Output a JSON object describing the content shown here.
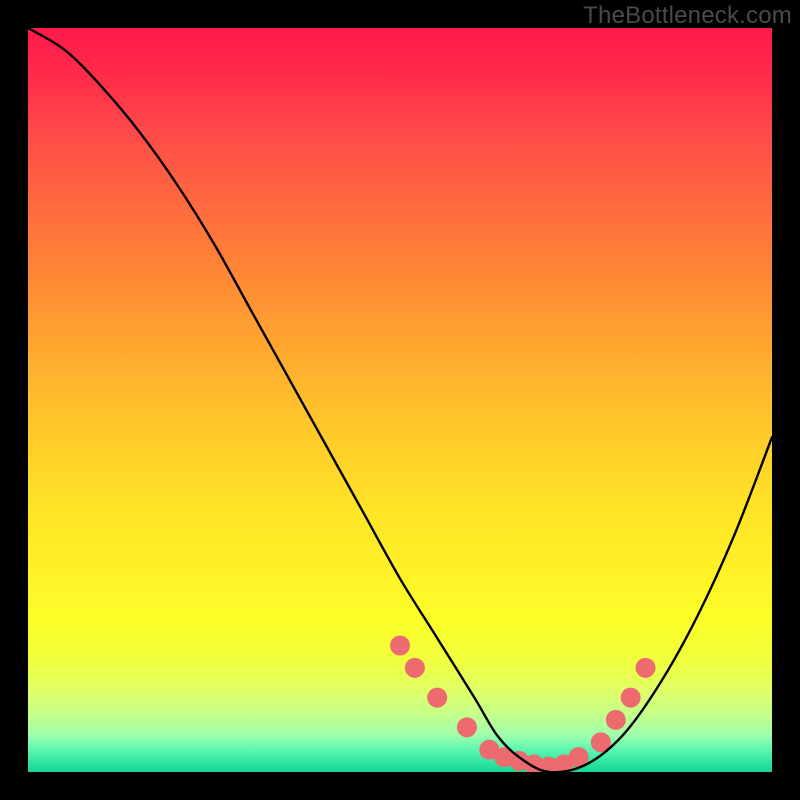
{
  "watermark": "TheBottleneck.com",
  "chart_data": {
    "type": "line",
    "title": "",
    "xlabel": "",
    "ylabel": "",
    "xlim": [
      0,
      100
    ],
    "ylim": [
      0,
      100
    ],
    "grid": false,
    "series": [
      {
        "name": "bottleneck-curve",
        "x": [
          0,
          5,
          10,
          15,
          20,
          25,
          30,
          35,
          40,
          45,
          50,
          55,
          60,
          63,
          66,
          70,
          75,
          80,
          85,
          90,
          95,
          100
        ],
        "values": [
          100,
          97,
          92,
          86,
          79,
          71,
          62,
          53,
          44,
          35,
          26,
          18,
          10,
          5,
          2,
          0,
          1,
          5,
          12,
          21,
          32,
          45
        ]
      }
    ],
    "markers": {
      "name": "highlight-dots",
      "x": [
        50,
        52,
        55,
        59,
        62,
        64,
        66,
        68,
        70,
        72,
        74,
        77,
        79,
        81,
        83
      ],
      "values": [
        17,
        14,
        10,
        6,
        3,
        2,
        1.5,
        1,
        0.7,
        1,
        2,
        4,
        7,
        10,
        14
      ],
      "color": "#ed6a6f",
      "radius": 10
    },
    "background_gradient": {
      "top": "#ff1a4b",
      "mid": "#ffe227",
      "bottom": "#1fd392"
    }
  }
}
